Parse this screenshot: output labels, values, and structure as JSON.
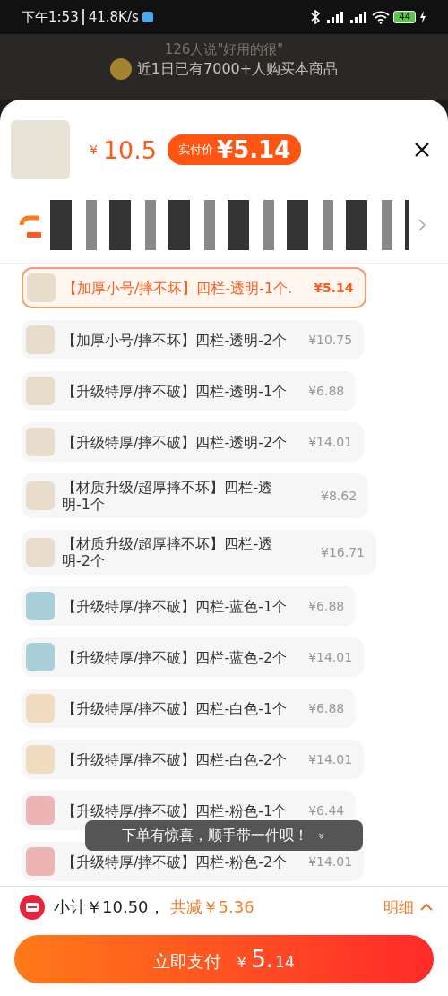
{
  "status_bar": {
    "time": "下午1:53",
    "speed": "41.8K/s",
    "battery": "44"
  },
  "background": {
    "review_banner": "126人说\"好用的很\"",
    "sales_banner": "近1日已有7000+人购买本商品"
  },
  "sheet": {
    "price_symbol": "¥",
    "price": "10.5",
    "pay_label": "实付价",
    "pay_price": "¥5.14",
    "options": [
      {
        "name": "【加厚小号/摔不坏】四栏-透明-1个.",
        "price": "¥5.14",
        "selected": true,
        "color": "#e8dccb"
      },
      {
        "name": "【加厚小号/摔不坏】四栏-透明-2个",
        "price": "¥10.75",
        "selected": false,
        "color": "#e8dccb"
      },
      {
        "name": "【升级特厚/摔不破】四栏-透明-1个",
        "price": "¥6.88",
        "selected": false,
        "color": "#e8dccb"
      },
      {
        "name": "【升级特厚/摔不破】四栏-透明-2个",
        "price": "¥14.01",
        "selected": false,
        "color": "#e8dccb"
      },
      {
        "name": "【材质升级/超厚摔不坏】四栏-透明-1个",
        "price": "¥8.62",
        "selected": false,
        "color": "#e8dccb"
      },
      {
        "name": "【材质升级/超厚摔不坏】四栏-透明-2个",
        "price": "¥16.71",
        "selected": false,
        "color": "#e8dccb"
      },
      {
        "name": "【升级特厚/摔不破】四栏-蓝色-1个",
        "price": "¥6.88",
        "selected": false,
        "color": "#a9cfd9"
      },
      {
        "name": "【升级特厚/摔不破】四栏-蓝色-2个",
        "price": "¥14.01",
        "selected": false,
        "color": "#a9cfd9"
      },
      {
        "name": "【升级特厚/摔不破】四栏-白色-1个",
        "price": "¥6.88",
        "selected": false,
        "color": "#f2dcc0"
      },
      {
        "name": "【升级特厚/摔不破】四栏-白色-2个",
        "price": "¥14.01",
        "selected": false,
        "color": "#f2dcc0"
      },
      {
        "name": "【升级特厚/摔不破】四栏-粉色-1个",
        "price": "¥6.44",
        "selected": false,
        "color": "#eeb4b4"
      },
      {
        "name": "【升级特厚/摔不破】四栏-粉色-2个",
        "price": "¥14.01",
        "selected": false,
        "color": "#eeb4b4"
      }
    ],
    "toast": {
      "text": "下单有惊喜，顺手带一件呗！",
      "icon": "»"
    }
  },
  "footer": {
    "subtotal": "小计￥10.50，",
    "discount": "共减￥5.36",
    "details": "明细",
    "pay_button": "立即支付",
    "pay_symbol": "￥",
    "pay_int": "5.",
    "pay_dec": "14"
  }
}
